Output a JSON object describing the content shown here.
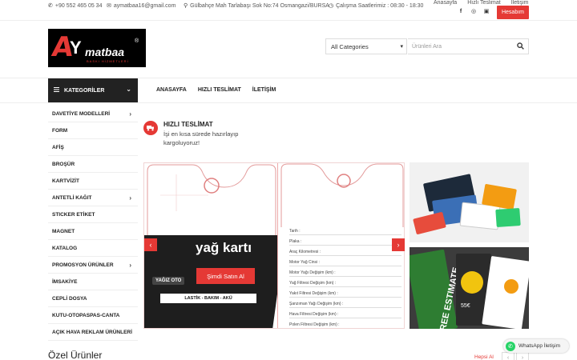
{
  "topbar": {
    "phone": "+90 552 465 05 34",
    "email": "aymatbaa16@gmail.com",
    "address": "Gülbahçe Mah Tarlabaşı Sok No:74 Osmangazi/BURSA",
    "hours": "Çalışma Saatlerimiz : 08:30 - 18:30",
    "links": [
      "Anasayfa",
      "Hızlı Teslimat",
      "İletişim"
    ],
    "account_button": "Hesabım",
    "social_icons": [
      "facebook-icon",
      "instagram-icon",
      "flickr-icon"
    ]
  },
  "logo": {
    "letter_a": "A",
    "letter_y": "Y",
    "text": "matbaa",
    "registered": "®",
    "subtitle": "BASKI HİZMETLERİ"
  },
  "search": {
    "category_select": "All Categories",
    "placeholder": "Ürünleri Ara"
  },
  "nav": {
    "categories_label": "KATEGORİLER",
    "items": [
      "ANASAYFA",
      "HIZLI TESLİMAT",
      "İLETİŞİM"
    ]
  },
  "sidebar": {
    "items": [
      {
        "label": "DAVETİYE MODELLERİ",
        "has_submenu": true
      },
      {
        "label": "FORM",
        "has_submenu": false
      },
      {
        "label": "AFİŞ",
        "has_submenu": false
      },
      {
        "label": "BROŞÜR",
        "has_submenu": false
      },
      {
        "label": "KARTVİZİT",
        "has_submenu": false
      },
      {
        "label": "ANTETLİ KAĞIT",
        "has_submenu": true
      },
      {
        "label": "STICKER ETİKET",
        "has_submenu": false
      },
      {
        "label": "MAGNET",
        "has_submenu": false
      },
      {
        "label": "KATALOG",
        "has_submenu": false
      },
      {
        "label": "PROMOSYON ÜRÜNLER",
        "has_submenu": true
      },
      {
        "label": "İMSAKİYE",
        "has_submenu": false
      },
      {
        "label": "CEPLİ DOSYA",
        "has_submenu": false
      },
      {
        "label": "KUTU-OTOPASPAS-CANTA",
        "has_submenu": false
      },
      {
        "label": "AÇIK HAVA REKLAM ÜRÜNLERİ",
        "has_submenu": false
      }
    ]
  },
  "feature": {
    "title": "HIZLI TESLİMAT",
    "text": "İşi en kısa sürede hazırlayıp kargoluyoruz!"
  },
  "slider": {
    "caption": "yağ kartı",
    "button": "Şimdi Satın Al",
    "brand": "YAĞIZ OTO",
    "service_bar": "LASTİK - BAKIM - AKÜ",
    "form_rows": [
      "Tarih :",
      "Plaka :",
      "Araç Kilometresi :",
      "Motor Yağ Cinsi :",
      "Motor Yağı Değişim (km) :",
      "Yağ Filtresi Değişim (km) :",
      "Yakıt Filtresi Değişim (km) :",
      "Şanzıman Yağı Değişim (km) :",
      "Hava Filtresi Değişim (km) :",
      "Polen Filtresi Değişim (km) :"
    ]
  },
  "promo": {
    "estimate_text": "FREE ESTIMATE",
    "price_text": "55€"
  },
  "special": {
    "title": "Özel Ürünler",
    "view_all": "Hepsi Al"
  },
  "whatsapp": {
    "label": "WhatsApp İletişim"
  },
  "colors": {
    "accent": "#e53935",
    "dark": "#222222"
  }
}
